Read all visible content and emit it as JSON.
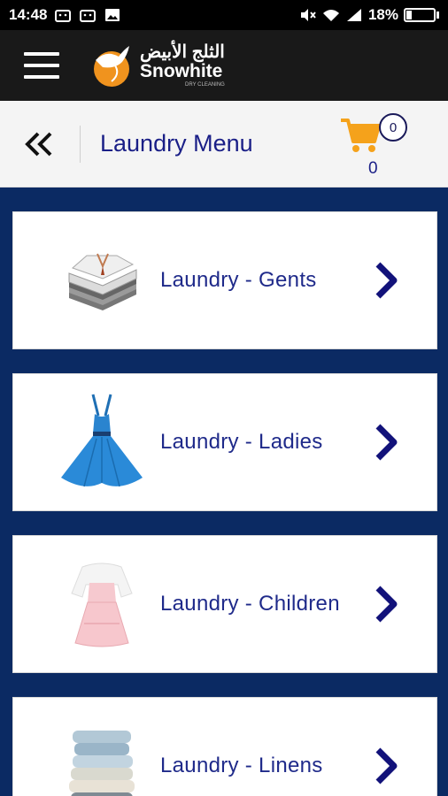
{
  "status_bar": {
    "time": "14:48",
    "battery": "18%"
  },
  "app_bar": {
    "logo_arabic": "الثلج الأبيض",
    "logo_english": "Snowhite",
    "logo_tagline": "DRY CLEANING"
  },
  "header": {
    "title": "Laundry Menu",
    "cart_badge": "0",
    "cart_count": "0"
  },
  "menu": {
    "items": [
      {
        "label": "Laundry - Gents",
        "icon": "folded-shirts-image"
      },
      {
        "label": "Laundry - Ladies",
        "icon": "blue-dress-image"
      },
      {
        "label": "Laundry - Children",
        "icon": "pink-kids-dress-image"
      },
      {
        "label": "Laundry - Linens",
        "icon": "folded-linens-image"
      }
    ]
  },
  "colors": {
    "background": "#0b2a63",
    "title": "#1a1f87",
    "cart": "#f5a21b",
    "chevron": "#12127a"
  }
}
